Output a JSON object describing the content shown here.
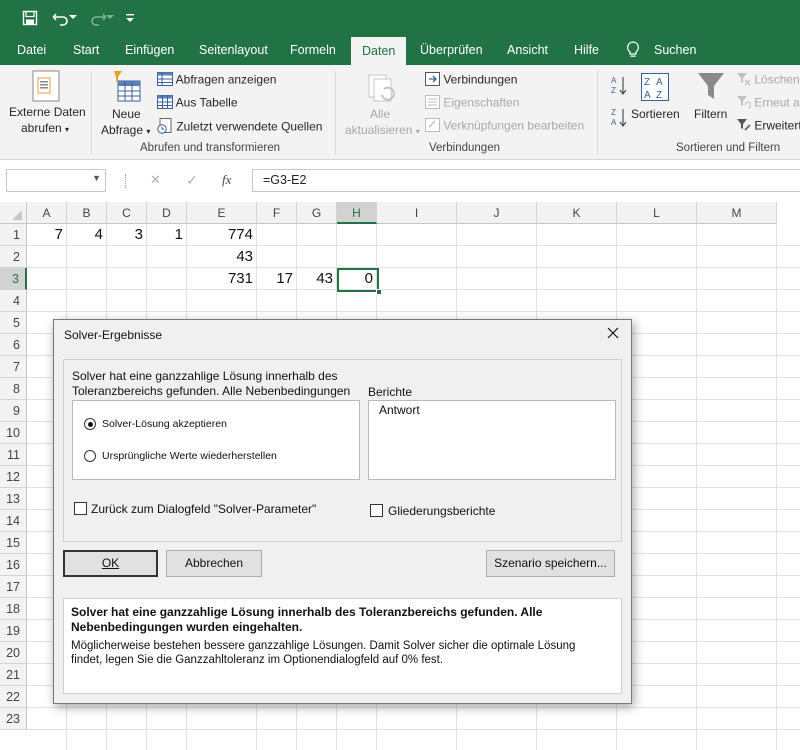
{
  "titlebar": {
    "save_icon": "save-icon",
    "undo_icon": "undo-icon",
    "redo_icon": "redo-icon",
    "customize_icon": "customize-quick-access-icon"
  },
  "tabs": [
    {
      "label": "Datei",
      "active": false
    },
    {
      "label": "Start",
      "active": false
    },
    {
      "label": "Einfügen",
      "active": false
    },
    {
      "label": "Seitenlayout",
      "active": false
    },
    {
      "label": "Formeln",
      "active": false
    },
    {
      "label": "Daten",
      "active": true
    },
    {
      "label": "Überprüfen",
      "active": false
    },
    {
      "label": "Ansicht",
      "active": false
    },
    {
      "label": "Hilfe",
      "active": false
    },
    {
      "label": "Suchen",
      "active": false
    }
  ],
  "ribbon": {
    "externe_daten_line1": "Externe Daten",
    "externe_daten_line2": "abrufen",
    "neue_abfrage_line1": "Neue",
    "neue_abfrage_line2": "Abfrage",
    "abfragen_anzeigen": "Abfragen anzeigen",
    "aus_tabelle": "Aus Tabelle",
    "zuletzt_quellen": "Zuletzt verwendete Quellen",
    "group_abrufen": "Abrufen und transformieren",
    "alle_line1": "Alle",
    "alle_line2": "aktualisieren",
    "verbindungen": "Verbindungen",
    "eigenschaften": "Eigenschaften",
    "verknuepfungen": "Verknüpfungen bearbeiten",
    "group_verbindungen": "Verbindungen",
    "sortieren": "Sortieren",
    "filtern": "Filtern",
    "loeschen": "Löschen",
    "erneut": "Erneut an",
    "erweitert": "Erweitert",
    "group_sortieren": "Sortieren und Filtern"
  },
  "formula_bar": {
    "name_box": "",
    "cancel_symbol": "✕",
    "enter_symbol": "✓",
    "fx_label": "fx",
    "formula": "=G3-E2"
  },
  "columns": [
    "A",
    "B",
    "C",
    "D",
    "E",
    "F",
    "G",
    "H",
    "I",
    "J",
    "K",
    "L",
    "M"
  ],
  "rows": [
    "1",
    "2",
    "3",
    "4",
    "5",
    "6",
    "7",
    "8",
    "9",
    "10",
    "11",
    "12",
    "13",
    "14",
    "15",
    "16",
    "17",
    "18",
    "19",
    "20",
    "21",
    "22",
    "23"
  ],
  "cells": {
    "A1": "7",
    "B1": "4",
    "C1": "3",
    "D1": "1",
    "E1": "774",
    "E2": "43",
    "E3": "731",
    "F3": "17",
    "G3": "43",
    "H3": "0"
  },
  "dialog": {
    "title": "Solver-Ergebnisse",
    "status_line1": "Solver hat eine ganzzahlige Lösung innerhalb des",
    "status_line2": "Toleranzbereichs gefunden. Alle Nebenbedingungen",
    "option_accept": "Solver-Lösung akzeptieren",
    "option_restore": "Ursprüngliche Werte wiederherstellen",
    "reports_label": "Berichte",
    "reports": [
      "Antwort"
    ],
    "checkbox_return": "Zurück zum Dialogfeld \"Solver-Parameter\"",
    "checkbox_outline": "Gliederungsberichte",
    "ok_label": "OK",
    "cancel_label": "Abbrechen",
    "save_scenario_label": "Szenario speichern...",
    "message_bold_line1": "Solver hat eine ganzzahlige Lösung innerhalb des Toleranzbereichs gefunden. Alle",
    "message_bold_line2": "Nebenbedingungen wurden eingehalten.",
    "message_line1": "Möglicherweise bestehen bessere ganzzahlige Lösungen. Damit Solver sicher die optimale Lösung",
    "message_line2": "findet, legen Sie die Ganzzahltoleranz im Optionendialogfeld auf 0% fest."
  }
}
